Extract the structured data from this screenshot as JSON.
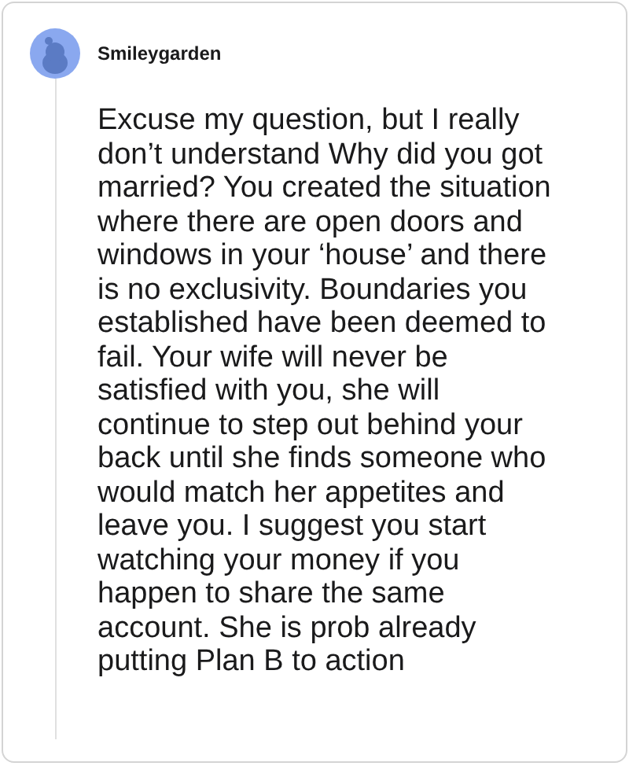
{
  "comment": {
    "author": "Smileygarden",
    "body": "Excuse my question, but I really don’t understand Why did you got married? You created the situation where there are open doors and windows in your ‘house’ and there is no exclusivity. Boundaries you established have been deemed to fail. Your wife will never be satisfied with you, she will continue to step out behind your back until she finds someone who would match her appetites and leave you. I suggest you start watching your money if you happen to share the same account. She is prob already putting Plan B to action"
  }
}
